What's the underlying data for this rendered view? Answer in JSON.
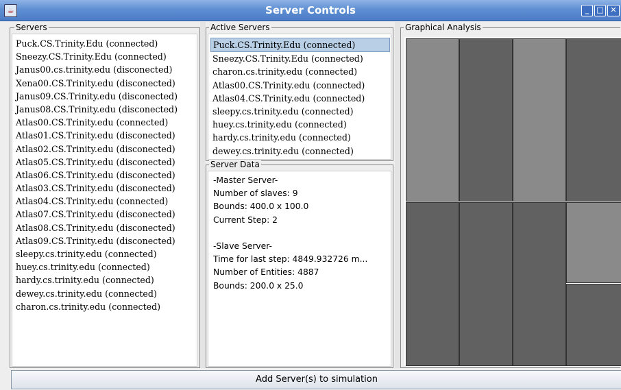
{
  "window": {
    "title": "Server Controls",
    "buttons": [
      "minimize",
      "maximize",
      "close"
    ]
  },
  "servers_panel": {
    "legend": "Servers",
    "items": [
      "Puck.CS.Trinity.Edu (connected)",
      "Sneezy.CS.Trinity.Edu (connected)",
      "Janus00.cs.trinity.edu (disconected)",
      "Xena00.CS.Trinity.edu (disconected)",
      "Janus09.CS.Trinity.edu (disconected)",
      "Janus08.CS.Trinity.edu (disconected)",
      "Atlas00.CS.Trinity.edu (connected)",
      "Atlas01.CS.Trinity.edu (disconected)",
      "Atlas02.CS.Trinity.edu (disconected)",
      "Atlas05.CS.Trinity.edu (disconected)",
      "Atlas06.CS.Trinity.edu (disconected)",
      "Atlas03.CS.Trinity.edu (disconected)",
      "Atlas04.CS.Trinity.edu (connected)",
      "Atlas07.CS.Trinity.edu (disconected)",
      "Atlas08.CS.Trinity.edu (disconected)",
      "Atlas09.CS.Trinity.edu (disconected)",
      "sleepy.cs.trinity.edu (connected)",
      "huey.cs.trinity.edu (connected)",
      "hardy.cs.trinity.edu (connected)",
      "dewey.cs.trinity.edu (connected)",
      "charon.cs.trinity.edu (connected)"
    ]
  },
  "active_panel": {
    "legend": "Active Servers",
    "items": [
      "Puck.CS.Trinity.Edu (connected)",
      "Sneezy.CS.Trinity.Edu (connected)",
      "charon.cs.trinity.edu (connected)",
      "Atlas00.CS.Trinity.edu (connected)",
      "Atlas04.CS.Trinity.edu (connected)",
      "sleepy.cs.trinity.edu (connected)",
      "huey.cs.trinity.edu (connected)",
      "hardy.cs.trinity.edu (connected)",
      "dewey.cs.trinity.edu (connected)"
    ],
    "selected_index": 0
  },
  "server_data": {
    "legend": "Server Data",
    "lines": [
      "-Master Server-",
      "Number of slaves: 9",
      "Bounds: 400.0 x 100.0",
      "Current Step: 2",
      "",
      "-Slave Server-",
      "Time for last step: 4849.932726 m...",
      "Number of Entities: 4887",
      "Bounds: 200.0 x 25.0"
    ]
  },
  "graphical_analysis": {
    "legend": "Graphical Analysis",
    "colors": {
      "light": "#8a8a8a",
      "dark": "#616161"
    }
  },
  "bottom_button": {
    "label": "Add Server(s) to simulation"
  }
}
